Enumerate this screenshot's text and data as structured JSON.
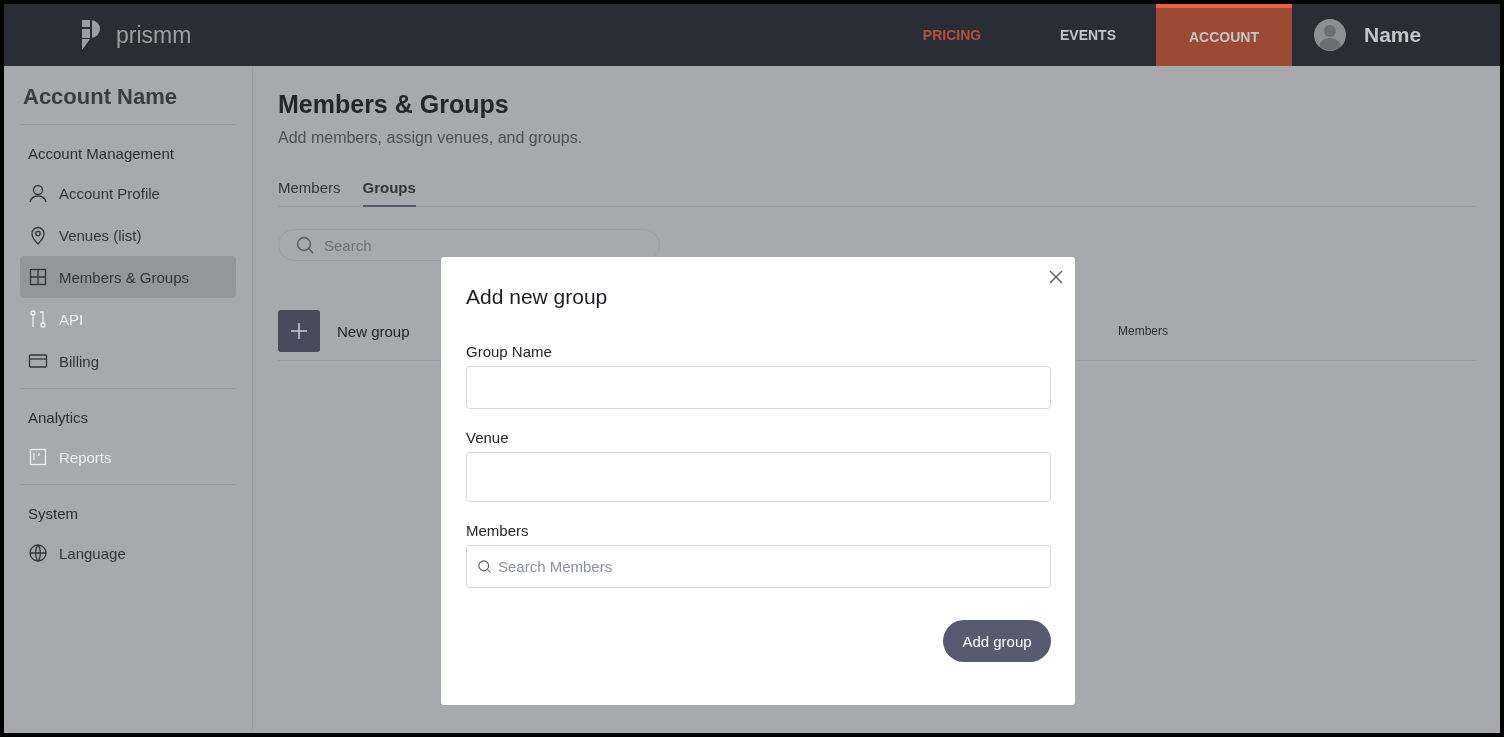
{
  "brand": {
    "name": "prismm"
  },
  "nav": [
    {
      "label": "PRICING",
      "selected": false,
      "highlight": true
    },
    {
      "label": "EVENTS",
      "selected": false,
      "highlight": false
    },
    {
      "label": "ACCOUNT",
      "selected": true,
      "highlight": false
    }
  ],
  "user": {
    "name": "Name"
  },
  "sidebar": {
    "title": "Account Name",
    "sections": [
      {
        "heading": "Account Management",
        "items": [
          {
            "label": "Account Profile",
            "kind": "user",
            "selected": false,
            "disabled": false
          },
          {
            "label": "Venues (list)",
            "kind": "pin",
            "selected": false,
            "disabled": false
          },
          {
            "label": "Members & Groups",
            "kind": "grid",
            "selected": true,
            "disabled": false
          },
          {
            "label": "API",
            "kind": "api",
            "selected": false,
            "disabled": true
          },
          {
            "label": "Billing",
            "kind": "card",
            "selected": false,
            "disabled": false
          }
        ]
      },
      {
        "heading": "Analytics",
        "items": [
          {
            "label": "Reports",
            "kind": "board",
            "selected": false,
            "disabled": true
          }
        ]
      },
      {
        "heading": "System",
        "items": [
          {
            "label": "Language",
            "kind": "globe",
            "selected": false,
            "disabled": false
          }
        ]
      }
    ]
  },
  "page": {
    "title": "Members & Groups",
    "subtitle": "Add members, assign venues, and groups.",
    "tabs": [
      {
        "label": "Members",
        "selected": false
      },
      {
        "label": "Groups",
        "selected": true
      }
    ],
    "search": {
      "placeholder": "Search"
    },
    "new_group": {
      "label": "New group"
    },
    "table": {
      "columns": [
        "Members"
      ]
    }
  },
  "modal": {
    "title": "Add new group",
    "fields": [
      {
        "label": "Group Name",
        "kind": "text"
      },
      {
        "label": "Venue",
        "kind": "select"
      },
      {
        "label": "Members",
        "kind": "search",
        "placeholder": "Search Members"
      }
    ],
    "submit": "Add group"
  }
}
